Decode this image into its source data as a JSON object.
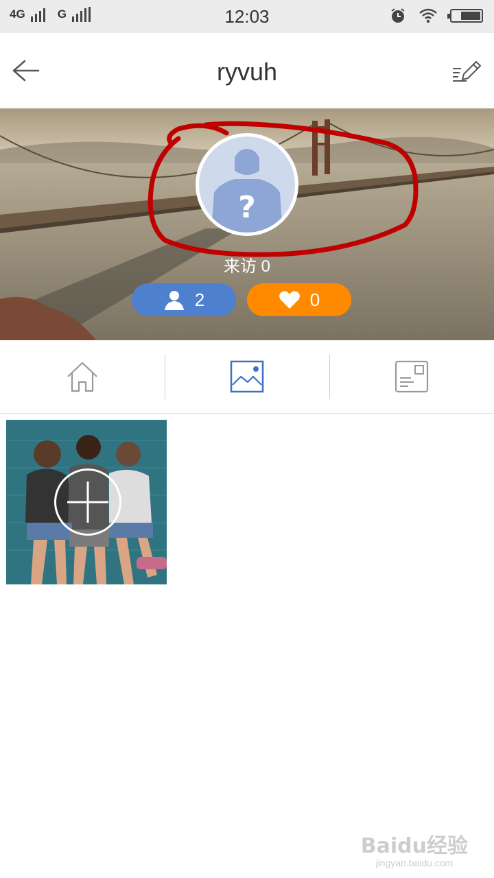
{
  "status_bar": {
    "network_1": "4G",
    "network_2": "G",
    "time": "12:03",
    "icons": [
      "signal-icon",
      "alarm-icon",
      "wifi-icon",
      "battery-icon"
    ],
    "battery_level": 0.7
  },
  "header": {
    "title": "ryvuh",
    "back_icon": "back-arrow-icon",
    "edit_icon": "edit-icon"
  },
  "profile": {
    "visit_label": "来访 0",
    "friends_count": "2",
    "likes_count": "0",
    "friends_color": "#4f7fcf",
    "likes_color": "#ff8a00",
    "annotation_color": "#c00000"
  },
  "tabs": [
    {
      "name": "home",
      "icon": "home-icon",
      "active": false
    },
    {
      "name": "photos",
      "icon": "image-icon",
      "active": true
    },
    {
      "name": "profile-card",
      "icon": "card-icon",
      "active": false
    }
  ],
  "accent": "#3e6fc4",
  "content": {
    "add_photo_icon": "plus-icon"
  },
  "watermark": {
    "main": "Baidu经验",
    "sub": "jingyan.baidu.com"
  }
}
